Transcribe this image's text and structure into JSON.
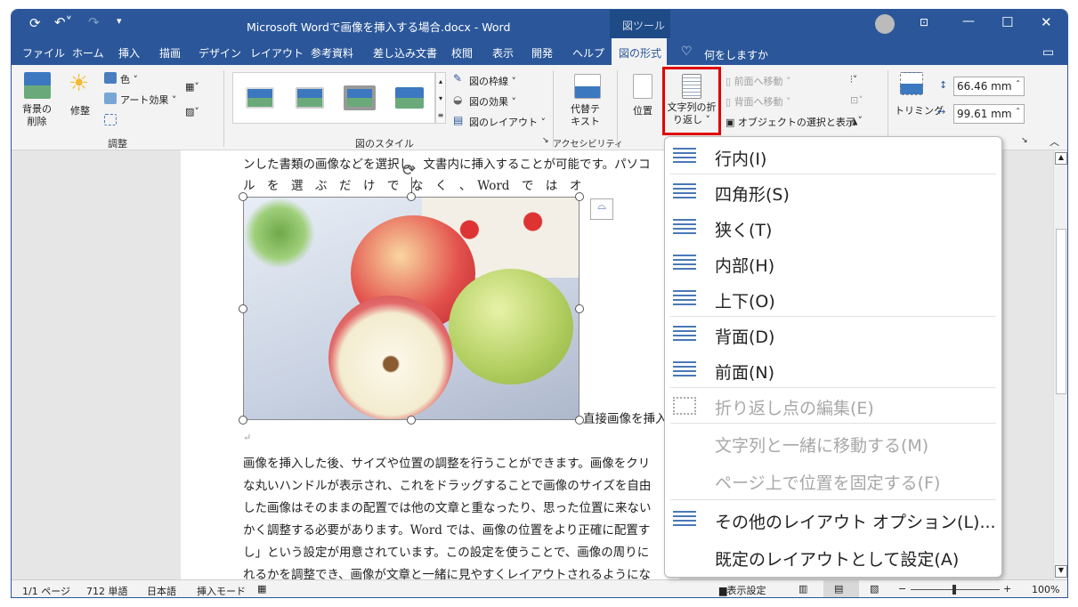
{
  "title_bar": {
    "doc_title": "Microsoft Wordで画像を挿入する場合.docx  -  Word",
    "context_tab": "図ツール"
  },
  "tabs": [
    "ファイル",
    "ホーム",
    "挿入",
    "描画",
    "デザイン",
    "レイアウト",
    "参考資料",
    "差し込み文書",
    "校閲",
    "表示",
    "開発",
    "ヘルプ",
    "図の形式"
  ],
  "active_tab": "図の形式",
  "tell_me": "何をしますか",
  "ribbon": {
    "remove_bg": [
      "背景の",
      "削除"
    ],
    "corrections": "修整",
    "color": "色",
    "art_effects": "アート効果",
    "group_adjust": "調整",
    "border": "図の枠線",
    "effects": "図の効果",
    "layout": "図のレイアウト",
    "group_styles": "図のスタイル",
    "alt_text": [
      "代替テ",
      "キスト"
    ],
    "group_access": "アクセシビリティ",
    "position": "位置",
    "wrap_text": [
      "文字列の折",
      "り返し"
    ],
    "bring_forward": "前面へ移動",
    "send_backward": "背面へ移動",
    "selection_pane": "オブジェクトの選択と表示",
    "crop": "トリミング",
    "height": "66.46 mm",
    "width": "99.61 mm"
  },
  "document": {
    "line1": "ンした書類の画像などを選択し、文書内に挿入することが可能です。パソコ",
    "line2": "ル　を　選　ぶ　だ　け　で　な　く　、　Word　で　は　オ",
    "beside_image": "直接画像を挿入",
    "para_mark": "↵",
    "paragraph": [
      "画像を挿入した後、サイズや位置の調整を行うことができます。画像をクリ",
      "な丸いハンドルが表示され、これをドラッグすることで画像のサイズを自由",
      "した画像はそのままの配置では他の文章と重なったり、思った位置に来ない",
      "かく調整する必要があります。Word では、画像の位置をより正確に配置す",
      "し」という設定が用意されています。この設定を使うことで、画像の周りに",
      "れるかを調整でき、画像が文章と一緒に見やすくレイアウトされるようにな"
    ]
  },
  "wrap_menu": {
    "items": [
      {
        "label": "行内(I)",
        "key": "I",
        "icon": "wrap-inline-icon",
        "enabled": true
      },
      {
        "label": "四角形(S)",
        "key": "S",
        "icon": "wrap-square-icon",
        "enabled": true
      },
      {
        "label": "狭く(T)",
        "key": "T",
        "icon": "wrap-tight-icon",
        "enabled": true
      },
      {
        "label": "内部(H)",
        "key": "H",
        "icon": "wrap-through-icon",
        "enabled": true
      },
      {
        "label": "上下(O)",
        "key": "O",
        "icon": "wrap-top-bottom-icon",
        "enabled": true
      },
      {
        "label": "背面(D)",
        "key": "D",
        "icon": "wrap-behind-icon",
        "enabled": true
      },
      {
        "label": "前面(N)",
        "key": "N",
        "icon": "wrap-front-icon",
        "enabled": true
      },
      {
        "label": "折り返し点の編集(E)",
        "key": "E",
        "icon": "edit-wrap-points-icon",
        "enabled": false
      },
      {
        "label": "文字列と一緒に移動する(M)",
        "key": "M",
        "enabled": false
      },
      {
        "label": "ページ上で位置を固定する(F)",
        "key": "F",
        "enabled": false
      },
      {
        "label": "その他のレイアウト オプション(L)...",
        "key": "L",
        "icon": "layout-options-icon",
        "enabled": true
      },
      {
        "label": "既定のレイアウトとして設定(A)",
        "key": "A",
        "enabled": true
      }
    ]
  },
  "status": {
    "page": "1/1 ページ",
    "words": "712 単語",
    "language": "日本語",
    "mode": "挿入モード",
    "display_settings": "表示設定",
    "zoom": "100%",
    "zoom_percent": 100
  },
  "colors": {
    "brand": "#2b579a",
    "highlight": "#e00000"
  }
}
